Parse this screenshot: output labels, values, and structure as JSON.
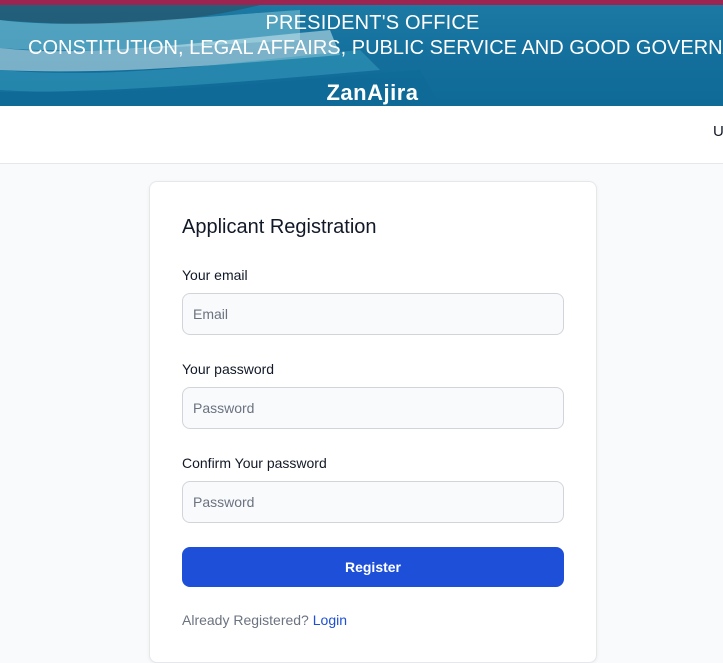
{
  "banner": {
    "line1": "PRESIDENT'S OFFICE",
    "line2": "CONSTITUTION, LEGAL AFFAIRS, PUBLIC SERVICE AND GOOD GOVERNANCE",
    "brand": "ZanAjira"
  },
  "navbar": {
    "link_partial": "U"
  },
  "form": {
    "title": "Applicant Registration",
    "email_label": "Your email",
    "email_placeholder": "Email",
    "password_label": "Your password",
    "password_placeholder": "Password",
    "confirm_label": "Confirm Your password",
    "confirm_placeholder": "Password",
    "submit_label": "Register",
    "already_text": "Already Registered?",
    "login_link": "Login"
  },
  "colors": {
    "banner": "#136e9b",
    "banner_top_stripe": "#9b2450",
    "primary": "#1d4fd8",
    "page_bg": "#f9fafb"
  }
}
